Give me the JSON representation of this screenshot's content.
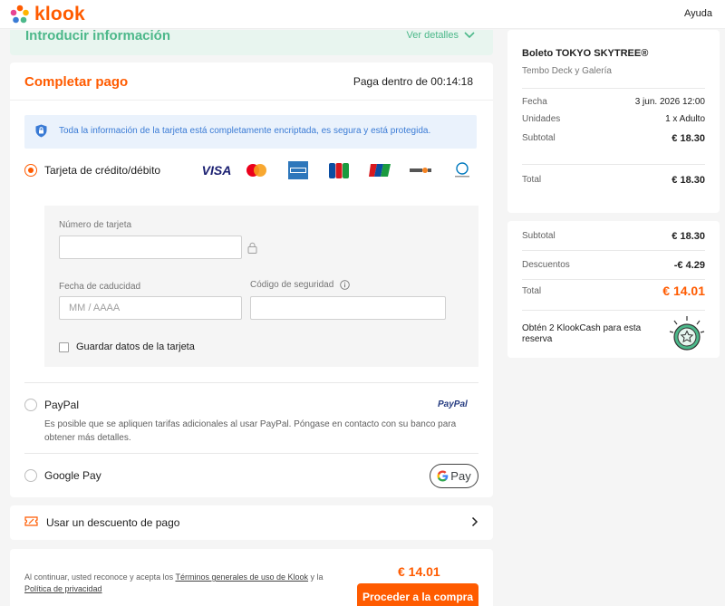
{
  "header": {
    "logo_text": "klook",
    "help_label": "Ayuda"
  },
  "intro": {
    "title": "Introducir información",
    "details_link": "Ver detalles"
  },
  "payment": {
    "title": "Completar pago",
    "timer": "Paga dentro de 00:14:18",
    "secure_notice": "Toda la información de la tarjeta está completamente encriptada, es segura y está protegida.",
    "card_option_label": "Tarjeta de crédito/débito",
    "card_brands": [
      "VISA",
      "mastercard-icon",
      "amex-icon",
      "jcb-icon",
      "unionpay-icon",
      "discover-icon",
      "diners-club-icon"
    ],
    "card_number_label": "Número de tarjeta",
    "card_number_value": "",
    "expiry_label": "Fecha de caducidad",
    "expiry_placeholder": "MM / AAAA",
    "security_code_label": "Código de seguridad",
    "security_code_value": "",
    "save_card_label": "Guardar datos de la tarjeta",
    "paypal_label": "PayPal",
    "paypal_brand": "PayPal",
    "paypal_note": "Es posible que se apliquen tarifas adicionales al usar PayPal. Póngase en contacto con su banco para obtener más detalles.",
    "gpay_label": "Google Pay",
    "gpay_button_text": "Pay"
  },
  "discount": {
    "label": "Usar un descuento de pago"
  },
  "footer": {
    "legal_prefix": "Al continuar, usted reconoce y acepta los ",
    "terms_link": "Términos generales de uso de Klook",
    "legal_mid": " y la ",
    "privacy_link": "Política de privacidad",
    "total": "€ 14.01",
    "proceed_label": "Proceder a la compra"
  },
  "summary": {
    "product": "Boleto TOKYO SKYTREE®",
    "package": "Tembo Deck y Galería",
    "date_label": "Fecha",
    "date_value": "3 jun. 2026 12:00",
    "units_label": "Unidades",
    "units_value": "1 x Adulto",
    "subtotal_label": "Subtotal",
    "subtotal_value": "€ 18.30",
    "total_label": "Total",
    "total_value": "€ 18.30"
  },
  "pricing": {
    "subtotal_label": "Subtotal",
    "subtotal_value": "€ 18.30",
    "discounts_label": "Descuentos",
    "discounts_value": "-€ 4.29",
    "total_label": "Total",
    "total_value": "€ 14.01",
    "klookcash_text": "Obtén 2 KlookCash para esta reserva"
  },
  "colors": {
    "accent": "#ff5b00",
    "green": "#4cb88a",
    "info_blue": "#3a7bd5"
  }
}
